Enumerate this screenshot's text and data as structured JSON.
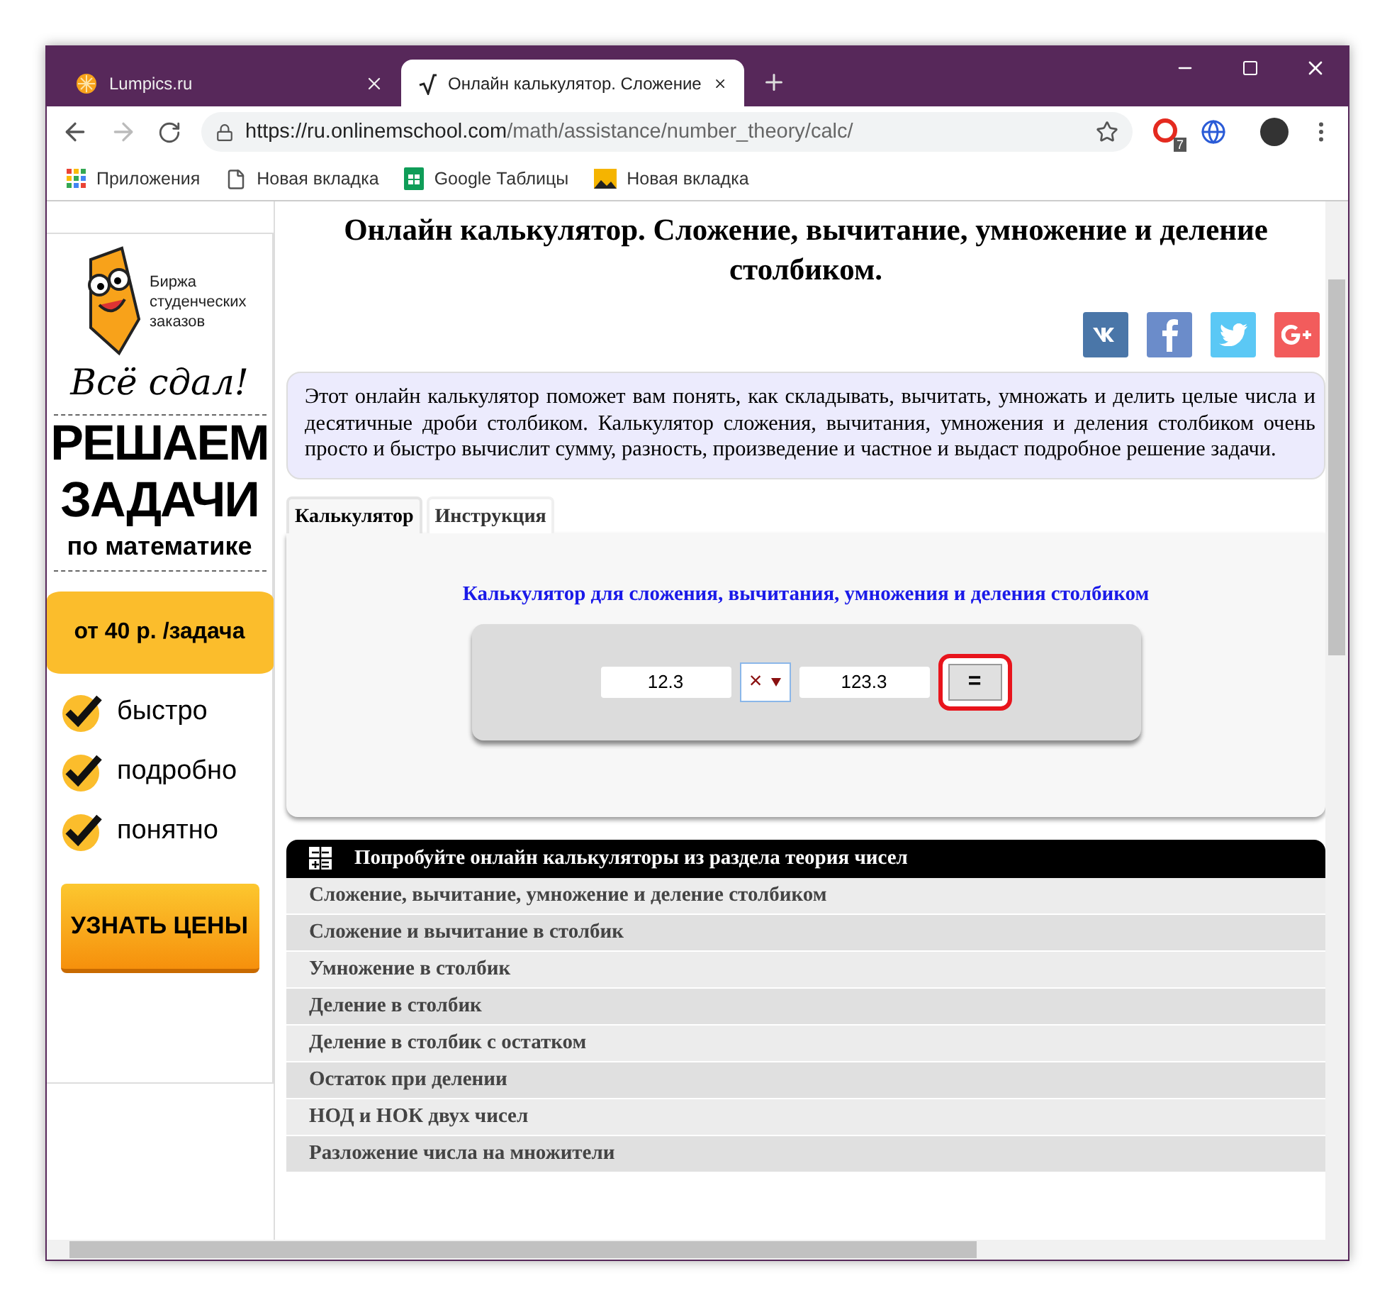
{
  "browser": {
    "tabs": [
      {
        "title": "Lumpics.ru",
        "selected": false,
        "kind": "orange"
      },
      {
        "title": "Онлайн калькулятор. Сложение",
        "selected": true,
        "kind": "math"
      }
    ],
    "address": {
      "host": "https://ru.onlinemschool.com",
      "path": "/math/assistance/number_theory/calc/"
    },
    "extension_badge": "7",
    "bookmarks": [
      {
        "label": "Приложения",
        "kind": "apps"
      },
      {
        "label": "Новая вкладка",
        "kind": "page"
      },
      {
        "label": "Google Таблицы",
        "kind": "sheets"
      },
      {
        "label": "Новая вкладка",
        "kind": "image"
      }
    ]
  },
  "ad": {
    "brand": "Биржа студенческих заказов",
    "slogan": "Всё сдал!",
    "headline": [
      "РЕШАЕМ",
      "ЗАДАЧИ"
    ],
    "subline": "по математике",
    "price": "от 40 р. /задача",
    "features": [
      "быстро",
      "подробно",
      "понятно"
    ],
    "button": "УЗНАТЬ ЦЕНЫ"
  },
  "page": {
    "title": "Онлайн калькулятор. Сложение, вычитание, умножение и деление столбиком.",
    "social": [
      {
        "kind": "vk"
      },
      {
        "kind": "facebook"
      },
      {
        "kind": "twitter"
      },
      {
        "kind": "googleplus"
      }
    ],
    "intro": "Этот онлайн калькулятор поможет вам понять, как складывать, вычитать, умножать и делить целые числа и десятичные дроби столбиком. Калькулятор сложения, вычитания, умножения и деления столбиком очень просто и быстро вычислит сумму, разность, произведение и частное и выдаст подробное решение задачи.",
    "tabs": [
      {
        "label": "Калькулятор",
        "selected": true
      },
      {
        "label": "Инструкция",
        "selected": false
      }
    ],
    "calculator": {
      "title": "Калькулятор для сложения, вычитания, умножения и деления столбиком",
      "a": "12.3",
      "operator": "×",
      "b": "123.3",
      "button": "=",
      "highlighted": true
    },
    "related": {
      "title": "Попробуйте онлайн калькуляторы из раздела теория чисел",
      "items": [
        "Сложение, вычитание, умножение и деление столбиком",
        "Сложение и вычитание в столбик",
        "Умножение в столбик",
        "Деление в столбик",
        "Деление в столбик с остатком",
        "Остаток при делении",
        "НОД и НОК двух чисел",
        "Разложение числа на множители"
      ]
    }
  }
}
